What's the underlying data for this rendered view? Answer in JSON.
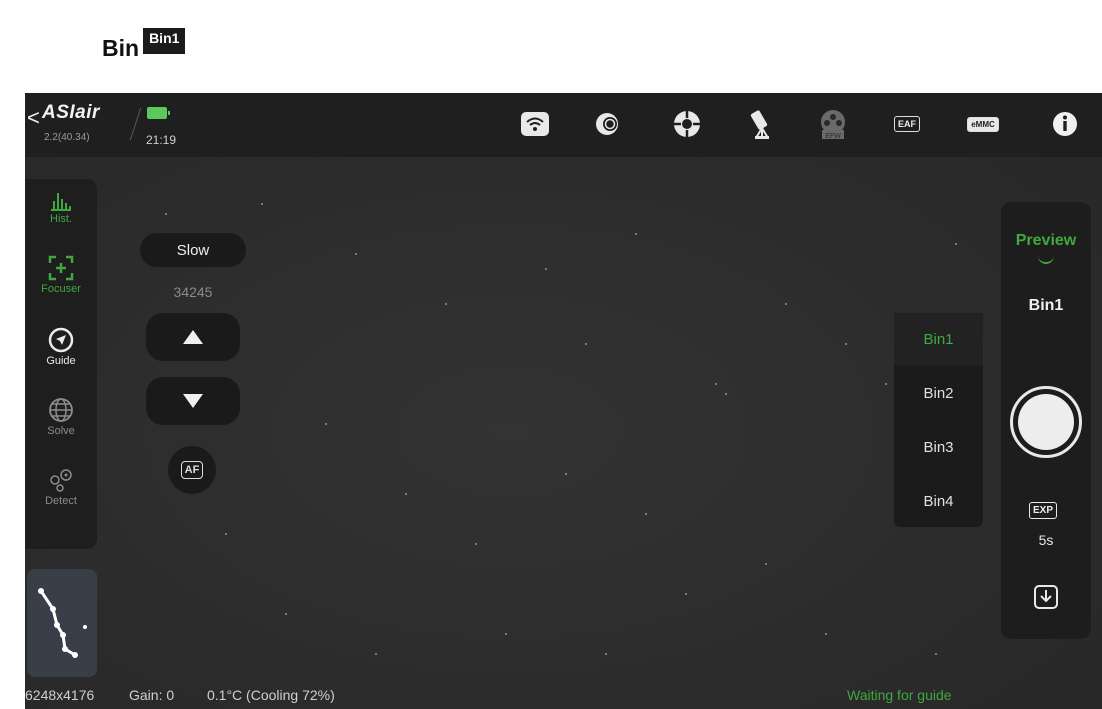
{
  "doc_title": {
    "word": "Bin",
    "chip": "Bin1"
  },
  "topbar": {
    "back_glyph": "<",
    "brand": "ASIair",
    "version": "2.2(40.34)",
    "time": "21:19",
    "eaf_label": "EAF",
    "emmc_label": "eMMC",
    "efw_label": "EFW"
  },
  "leftbar": {
    "items": [
      {
        "label": "Hist."
      },
      {
        "label": "Focuser"
      },
      {
        "label": "Guide"
      },
      {
        "label": "Solve"
      },
      {
        "label": "Detect"
      }
    ]
  },
  "focuser": {
    "speed": "Slow",
    "position": "34245",
    "af_label": "AF"
  },
  "bin_menu": {
    "options": [
      "Bin1",
      "Bin2",
      "Bin3",
      "Bin4"
    ],
    "selected": "Bin1"
  },
  "right_panel": {
    "mode": "Preview",
    "bin": "Bin1",
    "exp_icon": "EXP",
    "exposure": "5s"
  },
  "status": {
    "resolution": "6248x4176",
    "gain": "Gain: 0",
    "temperature": "0.1°C (Cooling 72%)",
    "guide_status": "Waiting for guide"
  },
  "colors": {
    "accent": "#3fa83f",
    "background": "#2c2c2c",
    "panel": "#1d1d1d"
  },
  "icons": [
    "wifi-icon",
    "camera-lens-icon",
    "guide-target-icon",
    "telescope-mount-icon",
    "filter-wheel-icon",
    "eaf-icon",
    "emmc-icon",
    "info-icon",
    "histogram-icon",
    "focuser-icon",
    "guide-icon",
    "globe-icon",
    "detect-icon",
    "up-arrow-icon",
    "down-arrow-icon",
    "af-icon",
    "shutter-icon",
    "exposure-icon",
    "download-icon"
  ]
}
